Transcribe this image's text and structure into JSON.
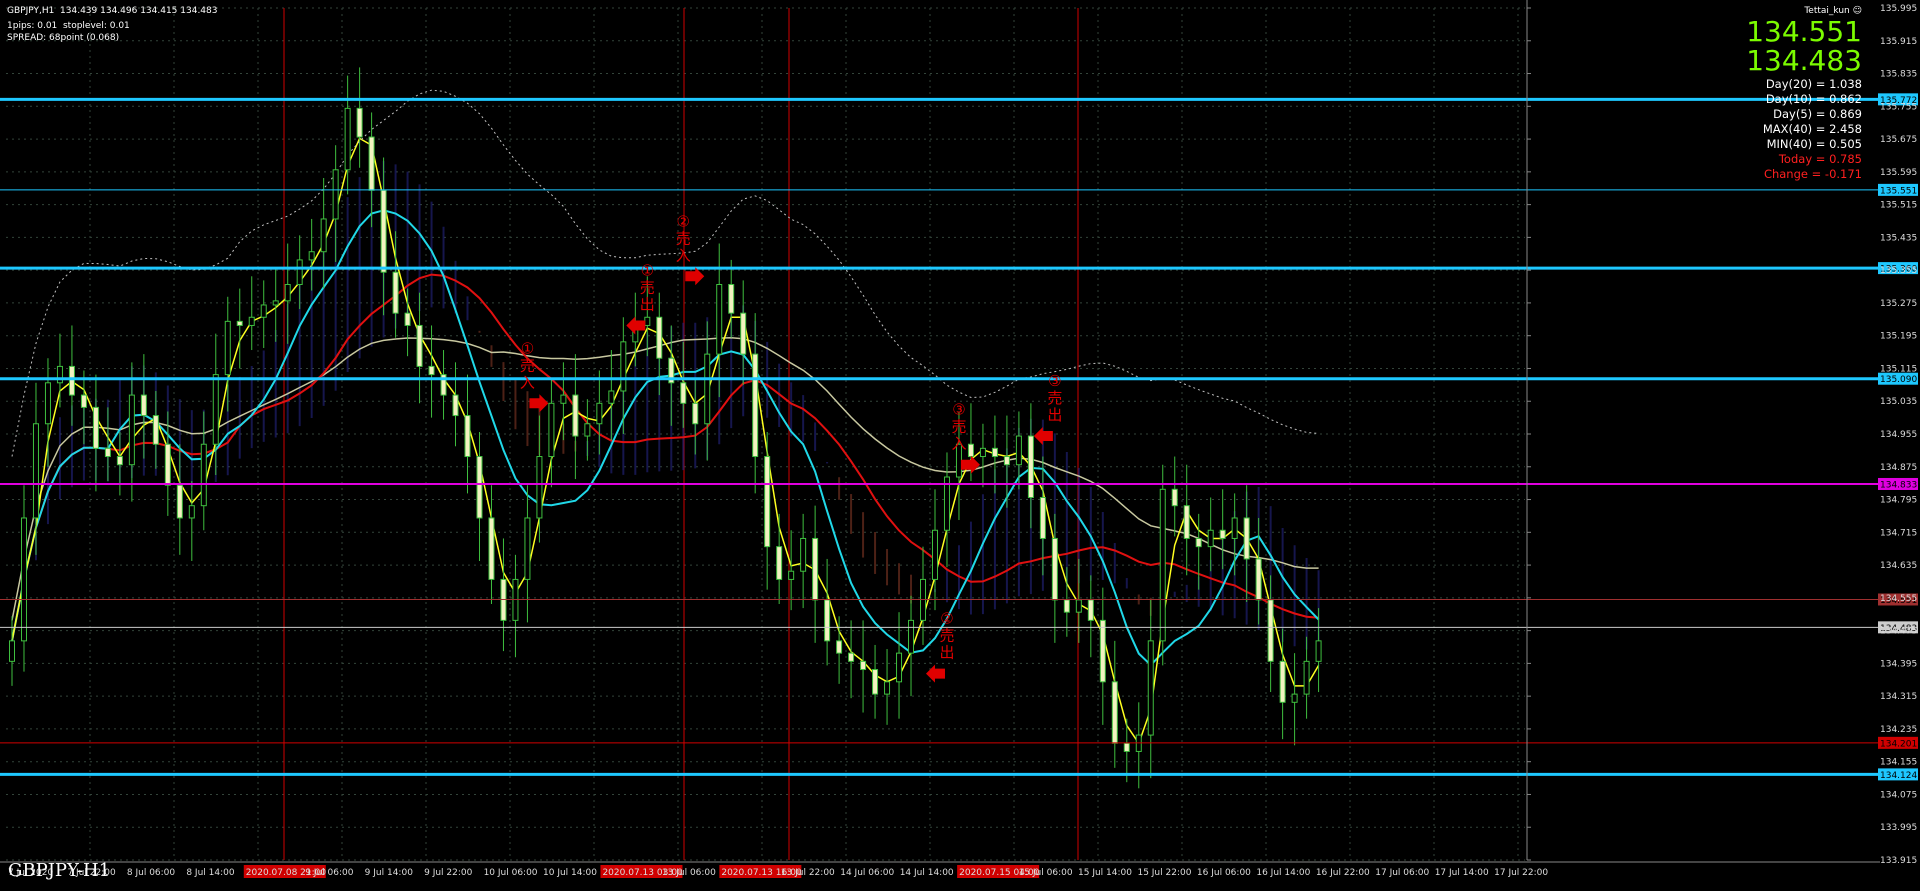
{
  "header": {
    "symbol_line": "GBPJPY,H1  134.439 134.496 134.415 134.483",
    "pips_line": "1pips: 0.01  stoplevel: 0.01",
    "spread_line": "SPREAD: 68point (0.068)"
  },
  "hud": {
    "user": "Tettai_kun",
    "bid": "134.551",
    "ask": "134.483",
    "stats": [
      {
        "text": "Day(20) = 1.038",
        "color": "#ffffff"
      },
      {
        "text": "Day(10) = 0.862",
        "color": "#ffffff"
      },
      {
        "text": "Day(5) = 0.869",
        "color": "#ffffff"
      },
      {
        "text": "MAX(40) = 2.458",
        "color": "#ffffff"
      },
      {
        "text": "MIN(40) = 0.505",
        "color": "#ffffff"
      },
      {
        "text": "Today = 0.785",
        "color": "#ff2020"
      },
      {
        "text": "Change = -0.171",
        "color": "#ff2020"
      }
    ]
  },
  "watermark": "GBPJPY-H1",
  "chart_data": {
    "type": "candlestick",
    "ylim": [
      133.915,
      135.995
    ],
    "y_ticks": [
      "135.995",
      "135.915",
      "135.835",
      "135.755",
      "135.675",
      "135.595",
      "135.515",
      "135.435",
      "135.355",
      "135.275",
      "135.195",
      "135.115",
      "135.035",
      "134.955",
      "134.875",
      "134.795",
      "134.715",
      "134.635",
      "134.555",
      "134.475",
      "134.395",
      "134.315",
      "134.235",
      "134.155",
      "134.075",
      "133.995",
      "133.915"
    ],
    "x_ticks": [
      {
        "label": "7 Jul 2020",
        "hl": false
      },
      {
        "label": "7 Jul 22:00",
        "hl": false
      },
      {
        "label": "8 Jul 06:00",
        "hl": false
      },
      {
        "label": "8 Jul 14:00",
        "hl": false
      },
      {
        "label": "2020.07.08 21:00",
        "hl": true
      },
      {
        "label": "9 Jul 06:00",
        "hl": false
      },
      {
        "label": "9 Jul 14:00",
        "hl": false
      },
      {
        "label": "9 Jul 22:00",
        "hl": false
      },
      {
        "label": "10 Jul 06:00",
        "hl": false
      },
      {
        "label": "10 Jul 14:00",
        "hl": false
      },
      {
        "label": "2020.07.13 03:00",
        "hl": true
      },
      {
        "label": "13 Jul 06:00",
        "hl": false
      },
      {
        "label": "2020.07.13 16:00",
        "hl": true
      },
      {
        "label": "13 Jul 22:00",
        "hl": false
      },
      {
        "label": "14 Jul 06:00",
        "hl": false
      },
      {
        "label": "14 Jul 14:00",
        "hl": false
      },
      {
        "label": "2020.07.15 04:00",
        "hl": true
      },
      {
        "label": "15 Jul 06:00",
        "hl": false
      },
      {
        "label": "15 Jul 14:00",
        "hl": false
      },
      {
        "label": "15 Jul 22:00",
        "hl": false
      },
      {
        "label": "16 Jul 06:00",
        "hl": false
      },
      {
        "label": "16 Jul 14:00",
        "hl": false
      },
      {
        "label": "16 Jul 22:00",
        "hl": false
      },
      {
        "label": "17 Jul 06:00",
        "hl": false
      },
      {
        "label": "17 Jul 14:00",
        "hl": false
      },
      {
        "label": "17 Jul 22:00",
        "hl": false
      }
    ],
    "h_levels": [
      {
        "price": 135.772,
        "label": "135.772",
        "color": "#1ec8ff",
        "width": 3
      },
      {
        "price": 135.551,
        "label": "135.551",
        "color": "#1ec8ff",
        "width": 1
      },
      {
        "price": 135.36,
        "label": "135.360",
        "color": "#1ec8ff",
        "width": 3
      },
      {
        "price": 135.09,
        "label": "135.090",
        "color": "#1ec8ff",
        "width": 3
      },
      {
        "price": 134.833,
        "label": "134.833",
        "color": "#e000e0",
        "width": 2
      },
      {
        "price": 134.551,
        "label": "134.551",
        "color": "#a03030",
        "width": 1
      },
      {
        "price": 134.483,
        "label": "134.483",
        "color": "#cccccc",
        "width": 1
      },
      {
        "price": 134.201,
        "label": "134.201",
        "color": "#d00000",
        "width": 1
      },
      {
        "price": 134.124,
        "label": "134.124",
        "color": "#1ec8ff",
        "width": 3
      }
    ],
    "close_series": [
      134.45,
      134.75,
      134.98,
      135.08,
      135.12,
      135.05,
      135.02,
      134.92,
      134.9,
      134.88,
      135.05,
      135.0,
      134.93,
      134.83,
      134.75,
      134.78,
      134.93,
      135.1,
      135.23,
      135.22,
      135.24,
      135.27,
      135.28,
      135.32,
      135.38,
      135.4,
      135.48,
      135.6,
      135.75,
      135.68,
      135.55,
      135.35,
      135.25,
      135.22,
      135.12,
      135.1,
      135.05,
      135.0,
      134.9,
      134.75,
      134.6,
      134.5,
      134.6,
      134.75,
      134.9,
      135.03,
      135.05,
      134.95,
      134.98,
      135.03,
      135.06,
      135.18,
      135.22,
      135.24,
      135.14,
      135.08,
      135.03,
      134.98,
      135.15,
      135.32,
      135.25,
      135.15,
      134.9,
      134.68,
      134.6,
      134.62,
      134.7,
      134.55,
      134.45,
      134.42,
      134.4,
      134.38,
      134.32,
      134.35,
      134.42,
      134.5,
      134.6,
      134.72,
      134.85,
      134.93,
      134.9,
      134.92,
      134.9,
      134.88,
      134.95,
      134.8,
      134.7,
      134.55,
      134.52,
      134.55,
      134.5,
      134.35,
      134.2,
      134.18,
      134.22,
      134.45,
      134.82,
      134.78,
      134.7,
      134.68,
      134.72,
      134.7,
      134.75,
      134.65,
      134.55,
      134.4,
      134.3,
      134.32,
      134.4,
      134.45
    ],
    "annotations": [
      {
        "label": "①売入",
        "kind": "right",
        "price": 135.03,
        "idx": 44
      },
      {
        "label": "①売出",
        "kind": "left",
        "price": 135.22,
        "idx": 52
      },
      {
        "label": "②売入",
        "kind": "right",
        "price": 135.34,
        "idx": 57
      },
      {
        "label": "②売出",
        "kind": "left",
        "price": 134.37,
        "idx": 77
      },
      {
        "label": "③売入",
        "kind": "right",
        "price": 134.88,
        "idx": 80
      },
      {
        "label": "③売出",
        "kind": "left",
        "price": 134.95,
        "idx": 86
      }
    ]
  }
}
